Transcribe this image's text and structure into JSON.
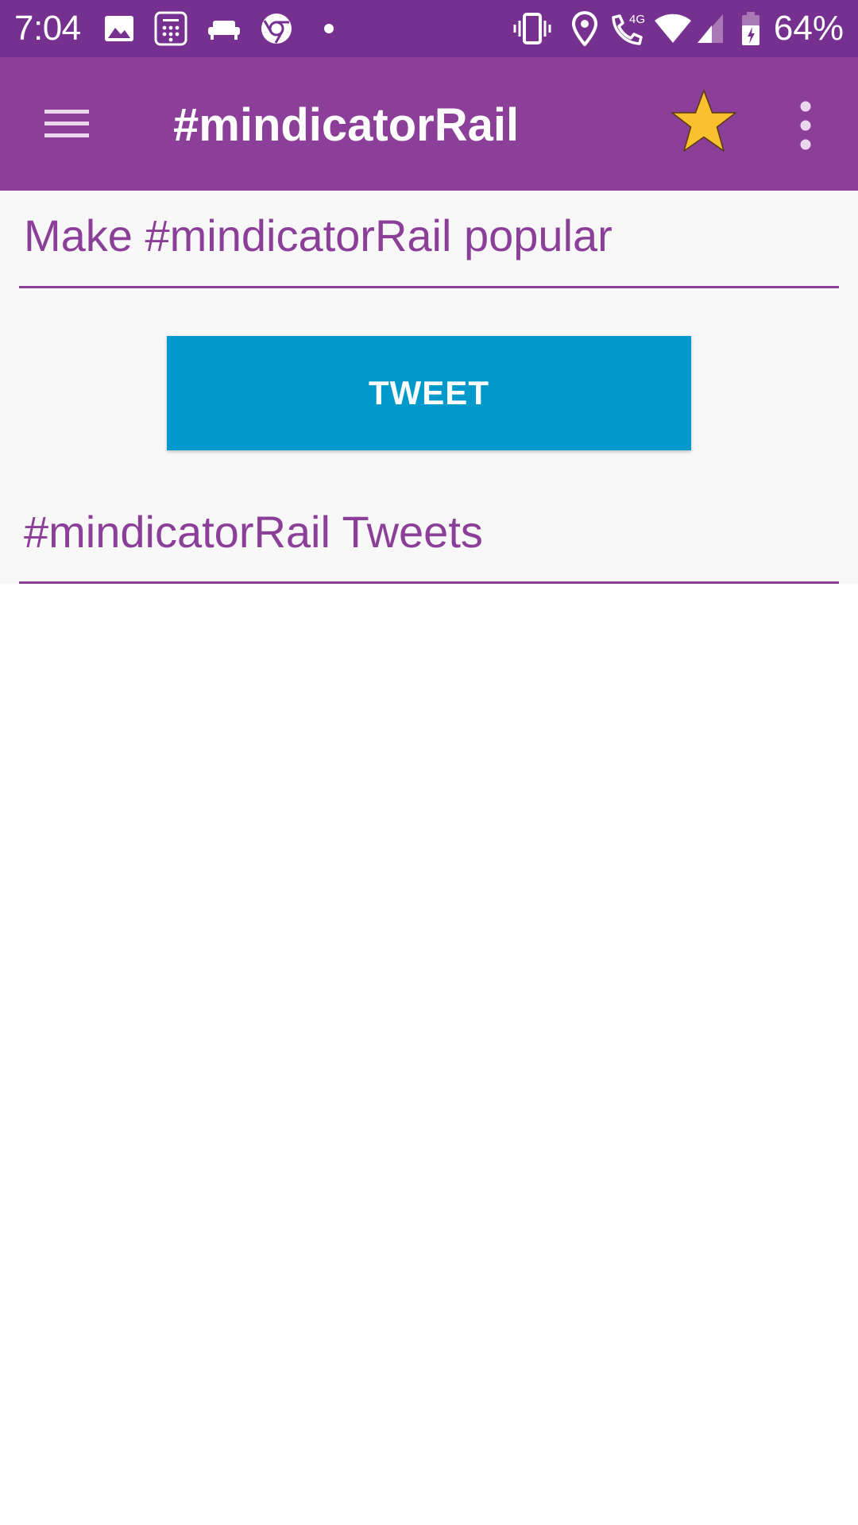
{
  "status_bar": {
    "time": "7:04",
    "battery_percent": "64%",
    "network_type": "4G",
    "icons_left": [
      "image-icon",
      "calculator-icon",
      "sofa-icon",
      "chrome-icon",
      "dot-icon"
    ],
    "icons_right": [
      "vibrate-icon",
      "location-icon",
      "wifi-call-icon",
      "wifi-icon",
      "signal-icon",
      "battery-charging-icon"
    ]
  },
  "app_bar": {
    "title": "#mindicatorRail",
    "star_color": "#fbc02d"
  },
  "main": {
    "promo_heading": "Make #mindicatorRail popular",
    "tweet_button_label": "TWEET",
    "tweets_heading": "#mindicatorRail Tweets"
  },
  "colors": {
    "status_bar": "#76308f",
    "app_bar": "#8b3f98",
    "accent": "#8b3f98",
    "tweet_button": "#0099cc"
  }
}
